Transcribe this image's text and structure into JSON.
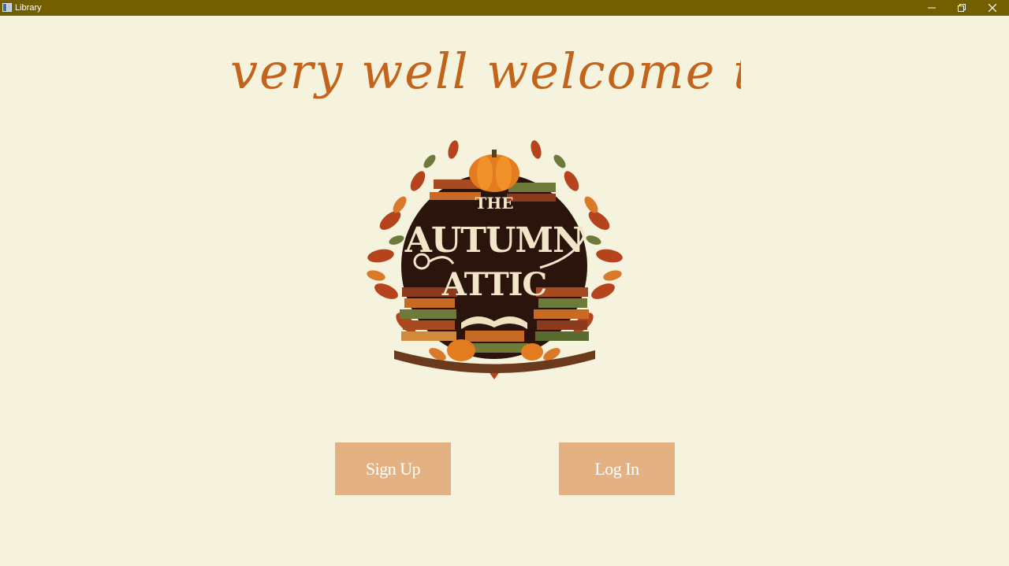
{
  "window": {
    "title": "Library",
    "controls": {
      "minimize": "minimize-icon",
      "maximize": "restore-icon",
      "close": "close-icon"
    }
  },
  "welcome": {
    "heading": "A very well welcome to",
    "color": "#c2641c"
  },
  "logo": {
    "line1": "THE",
    "line2": "AUTUMN",
    "line3": "ATTIC"
  },
  "actions": {
    "signup_label": "Sign Up",
    "login_label": "Log In",
    "button_color": "#e4b182"
  },
  "colors": {
    "titlebar": "#735e00",
    "background": "#f5f2dd"
  }
}
